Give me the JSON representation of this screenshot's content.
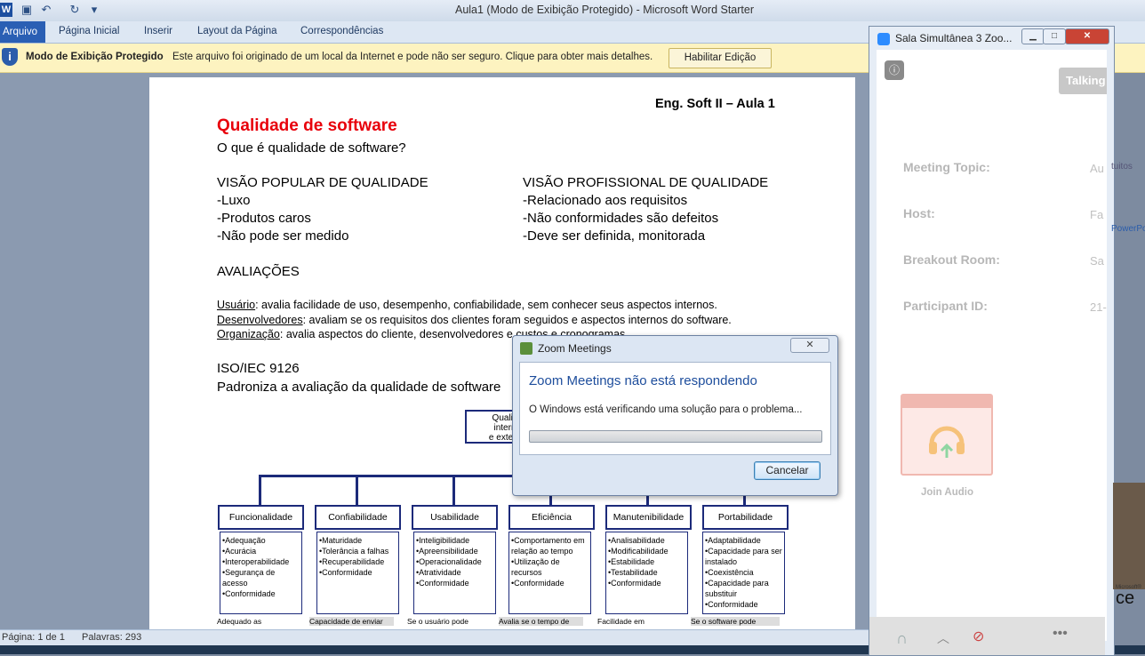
{
  "word": {
    "title": "Aula1 (Modo de Exibição Protegido)  -  Microsoft Word Starter",
    "app_icon": "W",
    "tabs": [
      "Arquivo",
      "Página Inicial",
      "Inserir",
      "Layout da Página",
      "Correspondências"
    ],
    "protected_bar": {
      "title": "Modo de Exibição Protegido",
      "message": "Este arquivo foi originado de um local da Internet e pode não ser seguro. Clique para obter mais detalhes.",
      "button": "Habilitar Edição"
    },
    "status": {
      "page": "Página: 1 de 1",
      "words": "Palavras: 293"
    }
  },
  "document": {
    "header_right": "Eng. Soft II – Aula 1",
    "title": "Qualidade de software",
    "question": "O que é qualidade de software?",
    "popular_heading": "VISÃO POPULAR DE QUALIDADE",
    "popular_items": [
      "-Luxo",
      "-Produtos caros",
      "-Não pode ser medido"
    ],
    "professional_heading": "VISÃO PROFISSIONAL DE QUALIDADE",
    "professional_items": [
      "-Relacionado aos requisitos",
      "-Não conformidades são defeitos",
      "-Deve ser definida, monitorada"
    ],
    "evaluations_heading": "AVALIAÇÕES",
    "evaluations": [
      {
        "who": "Usuário",
        "text": ": avalia facilidade de uso, desempenho, confiabilidade, sem conhecer seus aspectos internos."
      },
      {
        "who": "Desenvolvedores",
        "text": ": avaliam se os requisitos dos clientes foram seguidos e aspectos internos do software."
      },
      {
        "who": "Organização",
        "text": ": avalia aspectos do cliente, desenvolvedores e custos e cronogramas."
      }
    ],
    "iso_heading": "ISO/IEC 9126",
    "iso_text": "Padroniza a avaliação da qualidade de software",
    "diagram_root": [
      "Qualid",
      "intern",
      "e extern"
    ],
    "diagram": [
      {
        "name": "Funcionalidade",
        "items": [
          "•Adequação",
          "•Acurácia",
          "•Interoperabilidade",
          "•Segurança de acesso",
          "•Conformidade"
        ],
        "foot": "Adequado  as"
      },
      {
        "name": "Confiabilidade",
        "items": [
          "•Maturidade",
          "•Tolerância a falhas",
          "•Recuperabilidade",
          "•Conformidade"
        ],
        "foot": "Capacidade  de enviar"
      },
      {
        "name": "Usabilidade",
        "items": [
          "•Inteligibilidade",
          "•Apreensibilidade",
          "•Operacionalidade",
          "•Atratividade",
          "•Conformidade"
        ],
        "foot": "Se o usuário pode"
      },
      {
        "name": "Eficiência",
        "items": [
          "•Comportamento em relação ao tempo",
          "•Utilização de recursos",
          "•Conformidade"
        ],
        "foot": "Avalia se o tempo de"
      },
      {
        "name": "Manutenibilidade",
        "items": [
          "•Analisabilidade",
          "•Modificabilidade",
          "•Estabilidade",
          "•Testabilidade",
          "•Conformidade"
        ],
        "foot": "Facilidade em"
      },
      {
        "name": "Portabilidade",
        "items": [
          "•Adaptabilidade",
          "•Capacidade para ser instalado",
          "•Coexistência",
          "•Capacidade para substituir",
          "•Conformidade"
        ],
        "foot": "Se o software pode"
      }
    ]
  },
  "zoom": {
    "window_title": "Sala Simultânea 3   Zoo...",
    "talking": "Talking",
    "fields": [
      {
        "label": "Meeting Topic:",
        "value": "Au"
      },
      {
        "label": "Host:",
        "value": "Fa"
      },
      {
        "label": "Breakout Room:",
        "value": "Sa"
      },
      {
        "label": "Participant ID:",
        "value": "21-"
      }
    ],
    "side_snippets": [
      "tuitos",
      "PowerPo"
    ],
    "join_audio": "Join Audio",
    "office_text": "ce",
    "office_small": "Microsoft®"
  },
  "dialog": {
    "title": "Zoom Meetings",
    "heading": "Zoom Meetings não está respondendo",
    "message": "O Windows está verificando uma solução para o problema...",
    "cancel": "Cancelar"
  }
}
